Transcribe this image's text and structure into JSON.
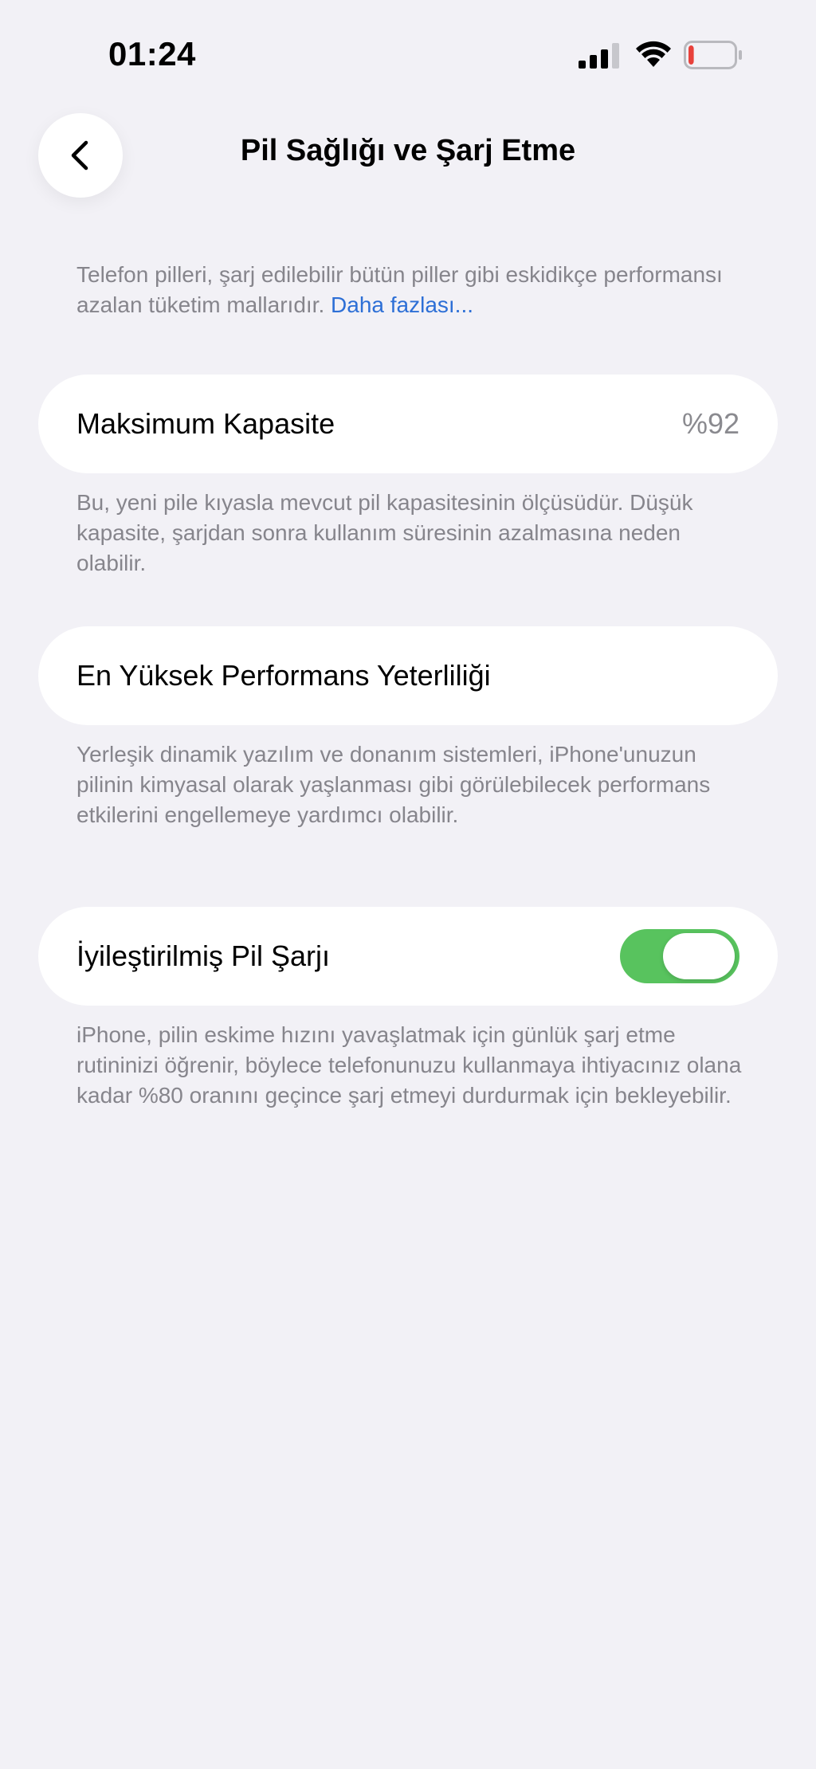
{
  "status_bar": {
    "time": "01:24",
    "icons": [
      "signal-icon",
      "wifi-icon",
      "battery-icon"
    ],
    "battery_level_percent": 12,
    "battery_color": "#E8413B"
  },
  "nav": {
    "title": "Pil Sağlığı ve Şarj Etme",
    "back_icon": "chevron-left-icon"
  },
  "intro": {
    "text": "Telefon pilleri, şarj edilebilir bütün piller gibi eskidikçe performansı azalan tüketim mallarıdır.",
    "link": "Daha fazlası..."
  },
  "max_capacity": {
    "label": "Maksimum Kapasite",
    "value": "%92",
    "footnote": "Bu, yeni pile kıyasla mevcut pil kapasitesinin ölçüsüdür. Düşük kapasite, şarjdan sonra kullanım süresinin azalmasına neden olabilir."
  },
  "peak_performance": {
    "label": "En Yüksek Performans Yeterliliği",
    "footnote": "Yerleşik dinamik yazılım ve donanım sistemleri, iPhone'unuzun pilinin kimyasal olarak yaşlanması gibi görülebilecek performans etkilerini engellemeye yardımcı olabilir."
  },
  "optimized_charging": {
    "label": "İyileştirilmiş Pil Şarjı",
    "enabled": true,
    "toggle_color": "#58C35E",
    "footnote": "iPhone, pilin eskime hızını yavaşlatmak için günlük şarj etme rutininizi öğrenir, böylece telefonunuzu kullanmaya ihtiyacınız olana kadar %80 oranını geçince şarj etmeyi durdurmak için bekleyebilir."
  },
  "colors": {
    "background": "#F2F1F6",
    "cell": "#FFFFFF",
    "secondary_text": "#86858C",
    "link": "#2D6FD6"
  }
}
